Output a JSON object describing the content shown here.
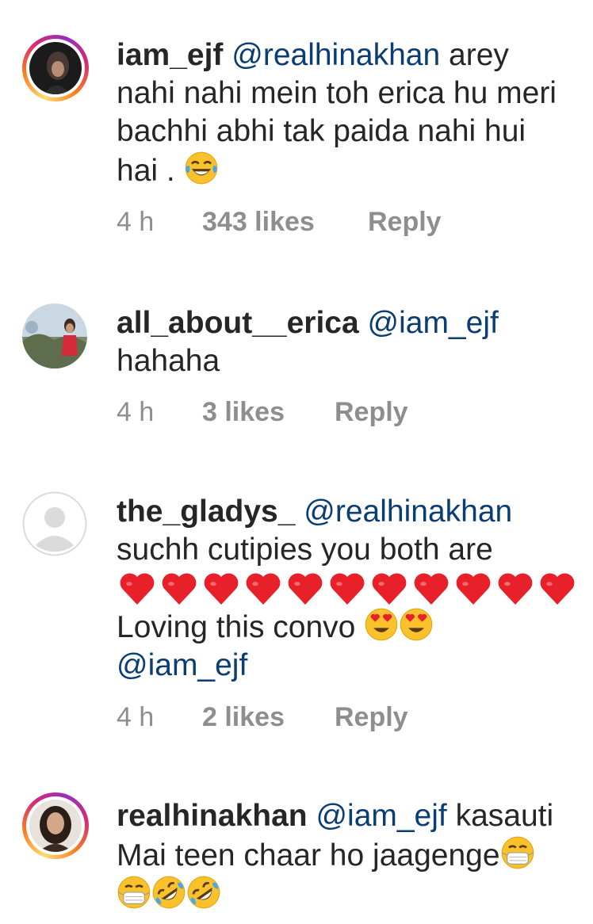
{
  "comments": [
    {
      "username": "iam_ejf",
      "mention": "@realhinakhan",
      "line1_rest": " arey",
      "line2": "nahi nahi mein toh erica hu meri",
      "line3": "bachhi abhi tak paida nahi hui",
      "line4": "hai .",
      "emoji": "face-with-tears-of-joy",
      "time": "4 h",
      "likes": "343 likes",
      "reply": "Reply"
    },
    {
      "username": "all_about__erica",
      "mention": "@iam_ejf",
      "line2": "hahaha",
      "time": "4 h",
      "likes": "3 likes",
      "reply": "Reply"
    },
    {
      "username": "the_gladys_",
      "mention": "@realhinakhan",
      "line2": "suchh cutipies you both are",
      "hearts_count": 11,
      "line4": "Loving this convo",
      "line5": "@iam_ejf",
      "emoji": "smiling-face-with-heart-eyes",
      "time": "4 h",
      "likes": "2 likes",
      "reply": "Reply"
    },
    {
      "username": "realhinakhan",
      "mention": "@iam_ejf",
      "line1_rest": " kasauti",
      "line2": "Mai teen chaar ho jaagenge",
      "emojis": [
        "face-with-medical-mask",
        "face-with-medical-mask",
        "rolling-on-the-floor-laughing",
        "rolling-on-the-floor-laughing"
      ]
    }
  ],
  "colors": {
    "text": "#262626",
    "meta": "#8e8e8e",
    "mention": "#0a3d73",
    "heart": "#e8202a",
    "emoji": "#f9c22c"
  }
}
